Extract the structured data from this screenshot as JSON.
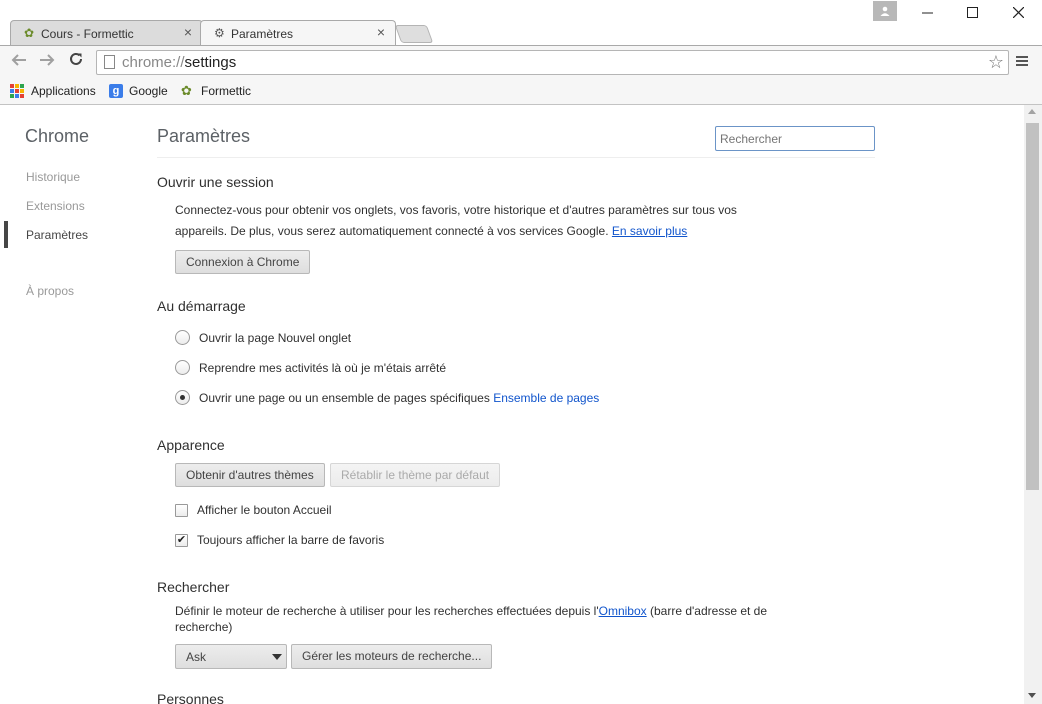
{
  "tabs": [
    {
      "label": "Cours - Formettic",
      "close": "×",
      "icon": "formettic-icon",
      "active": false
    },
    {
      "label": "Paramètres",
      "close": "×",
      "icon": "gear-icon",
      "active": true
    }
  ],
  "window": {
    "minimize": "–",
    "maximize": "☐",
    "close": "✕",
    "profile": "👤"
  },
  "toolbar": {
    "back": "←",
    "forward": "→",
    "reload": "↻",
    "url_scheme": "chrome://",
    "url_path": "settings",
    "star": "☆"
  },
  "bookmarks": [
    {
      "label": "Applications",
      "icon": "apps-grid-icon"
    },
    {
      "label": "Google",
      "icon": "google-icon",
      "glyph": "g"
    },
    {
      "label": "Formettic",
      "icon": "formettic-icon"
    }
  ],
  "sidebar": {
    "title": "Chrome",
    "items": [
      {
        "label": "Historique"
      },
      {
        "label": "Extensions"
      },
      {
        "label": "Paramètres",
        "selected": true
      },
      {
        "label": "À propos"
      }
    ]
  },
  "main": {
    "title": "Paramètres",
    "search_placeholder": "Rechercher",
    "signin": {
      "title": "Ouvrir une session",
      "line1": "Connectez-vous pour obtenir vos onglets, vos favoris, votre historique et d'autres paramètres sur tous vos",
      "line2": "appareils. De plus, vous serez automatiquement connecté à vos services Google.",
      "learn_more": "En savoir plus",
      "button": "Connexion à Chrome"
    },
    "startup": {
      "title": "Au démarrage",
      "options": [
        {
          "label": "Ouvrir la page Nouvel onglet",
          "checked": false
        },
        {
          "label": "Reprendre mes activités là où je m'étais arrêté",
          "checked": false
        },
        {
          "label": "Ouvrir une page ou un ensemble de pages spécifiques",
          "checked": true
        }
      ],
      "set_pages_link": "Ensemble de pages"
    },
    "appearance": {
      "title": "Apparence",
      "get_themes": "Obtenir d'autres thèmes",
      "reset_theme": "Rétablir le thème par défaut",
      "show_home": "Afficher le bouton Accueil",
      "show_home_checked": false,
      "show_bookmarks": "Toujours afficher la barre de favoris",
      "show_bookmarks_checked": true,
      "check_mark": "✔"
    },
    "search": {
      "title": "Rechercher",
      "desc_before": "Définir le moteur de recherche à utiliser pour les recherches effectuées depuis l'",
      "omnibox_link": "Omnibox",
      "desc_after": " (barre d'adresse et de",
      "desc_line2": "recherche)",
      "engine": "Ask",
      "manage_button": "Gérer les moteurs de recherche..."
    },
    "people": {
      "title": "Personnes"
    }
  },
  "colors": {
    "accent": "#1155cc",
    "focus_border": "#6b94c7",
    "sidebar_marker": "#464646"
  }
}
